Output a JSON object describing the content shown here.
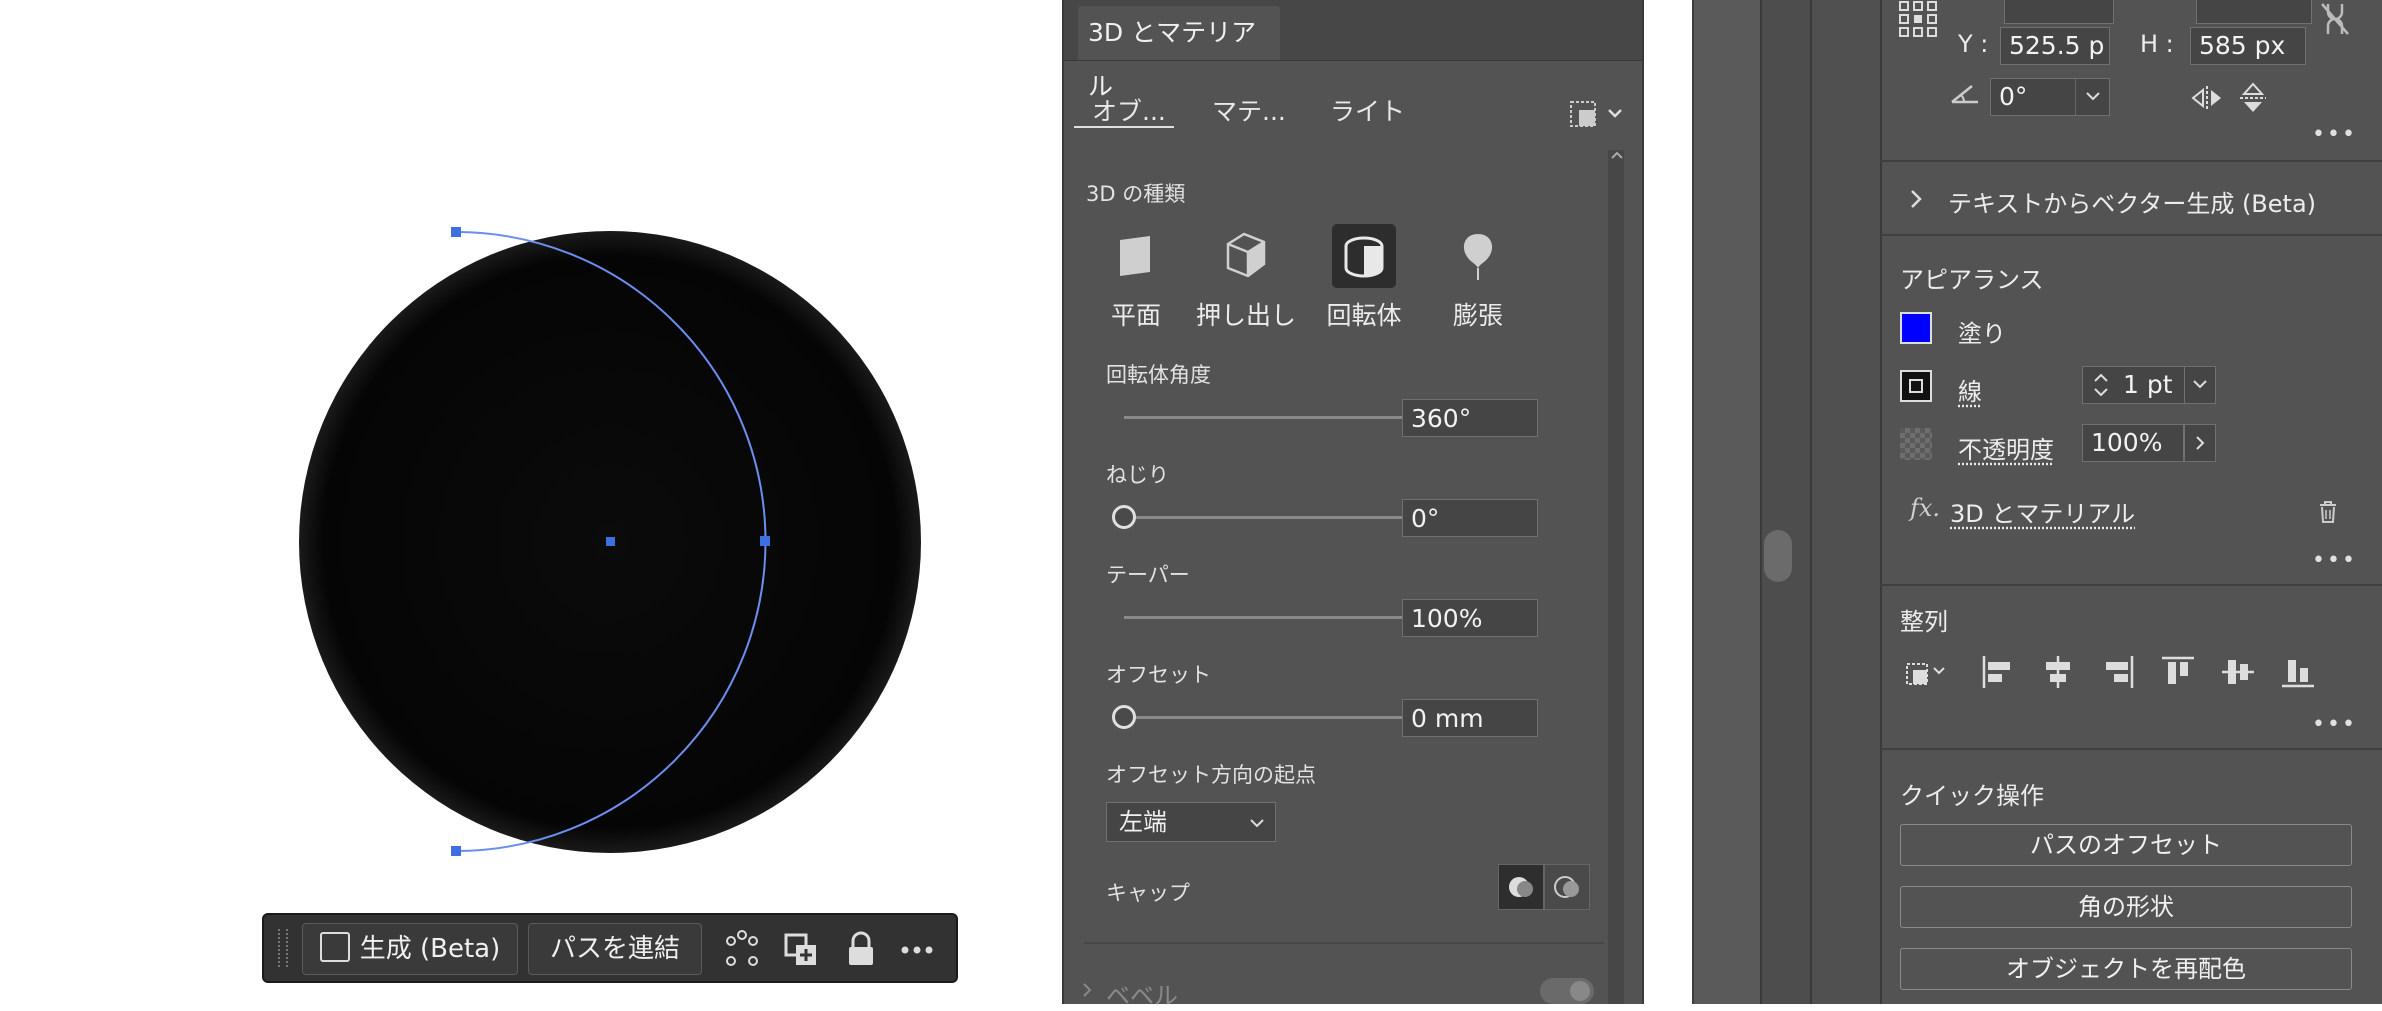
{
  "canvas": {
    "toolbar": {
      "generate_label": "生成 (Beta)",
      "join_label": "パスを連結"
    }
  },
  "panel3d": {
    "title": "3D とマテリアル",
    "tabs": [
      "オブ...",
      "マテ...",
      "ライト"
    ],
    "type_heading": "3D の種類",
    "types": [
      "平面",
      "押し出し",
      "回転体",
      "膨張"
    ],
    "selected_type": "回転体",
    "revolve_angle": {
      "label": "回転体角度",
      "value": "360°",
      "fraction": 1.0
    },
    "twist": {
      "label": "ねじり",
      "value": "0°",
      "fraction": 0.0
    },
    "taper": {
      "label": "テーパー",
      "value": "100%",
      "fraction": 1.0
    },
    "offset": {
      "label": "オフセット",
      "value": "0 mm",
      "fraction": 0.0
    },
    "offset_origin": {
      "label": "オフセット方向の起点",
      "value": "左端"
    },
    "cap_label": "キャップ",
    "bevel_label": "ベベル"
  },
  "properties": {
    "transform": {
      "y_label": "Y :",
      "y_value": "525.5 p",
      "h_label": "H :",
      "h_value": "585 px",
      "angle_value": "0°"
    },
    "text_to_vector": "テキストからベクター生成 (Beta)",
    "appearance": {
      "heading": "アピアランス",
      "fill_label": "塗り",
      "fill_color": "#0000ff",
      "stroke_label": "線",
      "stroke_value": "1 pt",
      "opacity_label": "不透明度",
      "opacity_value": "100%",
      "effect_label": "3D とマテリアル"
    },
    "align_heading": "整列",
    "quick_actions": {
      "heading": "クイック操作",
      "buttons": [
        "パスのオフセット",
        "角の形状",
        "オブジェクトを再配色"
      ]
    }
  },
  "colors": {
    "panel_bg": "#535353",
    "accent": "#4a7fe0"
  }
}
